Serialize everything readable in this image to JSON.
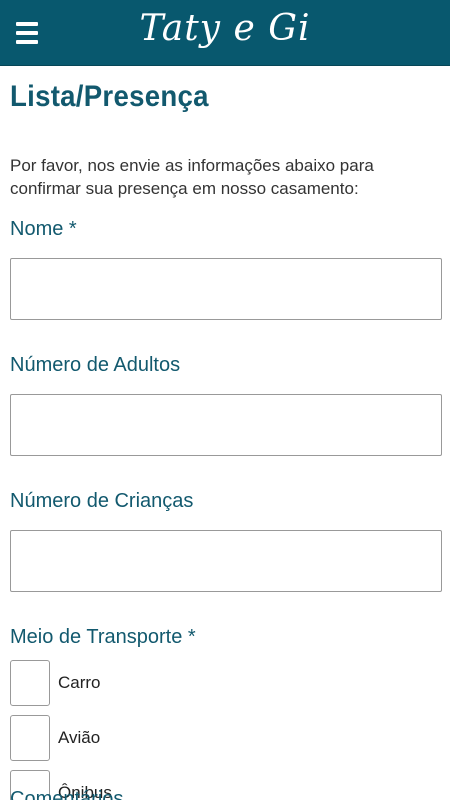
{
  "header": {
    "menu_icon": "hamburger-menu-icon",
    "brand": "Taty e Gi",
    "background": "#08586e"
  },
  "main": {
    "title": "Lista/Presença",
    "intro": "Por favor, nos envie as informações abaixo para confirmar sua presença em nosso casamento:",
    "fields": {
      "nome": {
        "label": "Nome *",
        "value": ""
      },
      "adultos": {
        "label": "Número de Adultos",
        "value": ""
      },
      "criancas": {
        "label": "Número de Crianças",
        "value": ""
      }
    },
    "transporte": {
      "label": "Meio de Transporte *",
      "options": [
        {
          "label": "Carro",
          "checked": false
        },
        {
          "label": "Avião",
          "checked": false
        },
        {
          "label": "Ônibus",
          "checked": false
        }
      ]
    },
    "next_label_partial": "Comentários"
  },
  "colors": {
    "accent": "#12596e",
    "border": "#999999"
  }
}
